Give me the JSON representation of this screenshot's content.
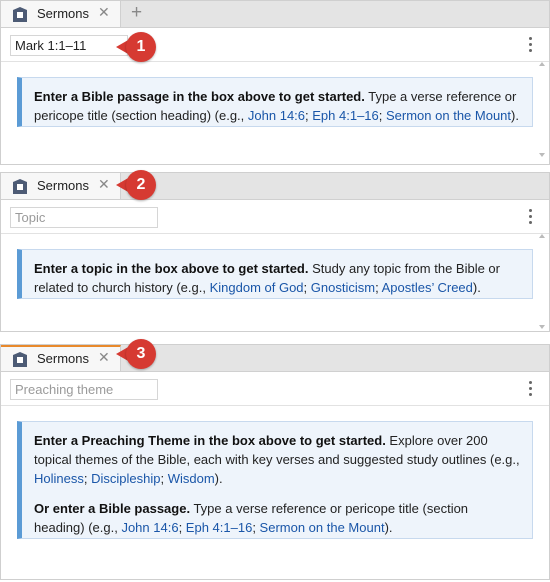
{
  "panels": [
    {
      "tab_label": "Sermons",
      "close_glyph": "✕",
      "add_glyph": "+",
      "input_value": "Mark 1:1–11",
      "input_placeholder": "",
      "callout": "1",
      "msg": {
        "bold": "Enter a Bible passage in the box above to get started.",
        "text": " Type a verse reference or pericope title (section heading) (e.g., ",
        "link1": "John 14:6",
        "sep1": "; ",
        "link2": "Eph 4:1–16",
        "sep2": "; ",
        "link3": "Sermon on the Mount",
        "end": ")."
      }
    },
    {
      "tab_label": "Sermons",
      "close_glyph": "✕",
      "input_value": "",
      "input_placeholder": "Topic",
      "callout": "2",
      "msg": {
        "bold": "Enter a topic in the box above to get started.",
        "text": " Study any topic from the Bible or related to church history (e.g., ",
        "link1": "Kingdom of God",
        "sep1": "; ",
        "link2": "Gnosticism",
        "sep2": "; ",
        "link3": "Apostles’ Creed",
        "end": ")."
      }
    },
    {
      "tab_label": "Sermons",
      "close_glyph": "✕",
      "input_value": "",
      "input_placeholder": "Preaching theme",
      "callout": "3",
      "msg": {
        "bold": "Enter a Preaching Theme in the box above to get started.",
        "text": " Explore over 200 topical themes of the Bible, each with key verses and suggested study outlines (e.g., ",
        "link1": "Holiness",
        "sep1": "; ",
        "link2": "Discipleship",
        "sep2": "; ",
        "link3": "Wisdom",
        "end": ").",
        "bold2": "Or enter a Bible passage.",
        "text2": " Type a verse reference or pericope title (section heading) (e.g., ",
        "link4": "John 14:6",
        "sep3": "; ",
        "link5": "Eph 4:1–16",
        "sep4": "; ",
        "link6": "Sermon on the Mount",
        "end2": ")."
      }
    }
  ],
  "colors": {
    "callout": "#d63a32",
    "link": "#1a56a8",
    "active_tab_accent": "#e8892c",
    "info_border": "#5b9bd5"
  },
  "icons": [
    "sermons-app-icon",
    "close-icon",
    "add-tab-icon",
    "more-options-icon"
  ]
}
